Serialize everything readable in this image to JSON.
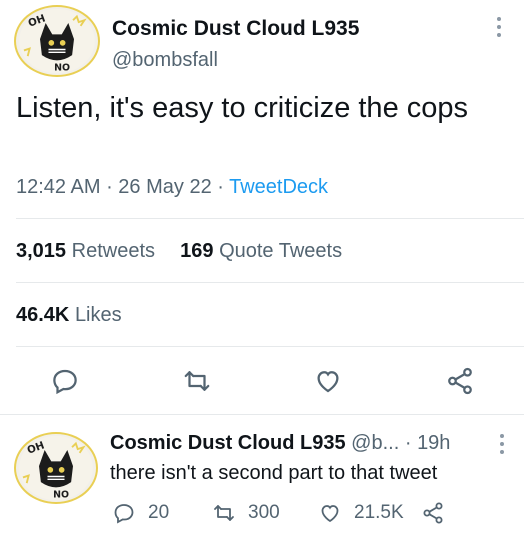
{
  "tweet": {
    "author_name": "Cosmic Dust Cloud L935",
    "author_handle": "@bombsfall",
    "text": "Listen, it's easy to criticize the cops",
    "time": "12:42 AM",
    "date": "26 May 22",
    "source": "TweetDeck",
    "retweets_count": "3,015",
    "retweets_label": "Retweets",
    "quotes_count": "169",
    "quotes_label": "Quote Tweets",
    "likes_count": "46.4K",
    "likes_label": "Likes"
  },
  "avatar": {
    "badge_text": "OH",
    "lower_text": "NO"
  },
  "reply": {
    "author_name": "Cosmic Dust Cloud L935",
    "author_handle": "@b...",
    "time": "19h",
    "text": "there isn't a second part to that tweet",
    "reply_count": "20",
    "retweet_count": "300",
    "like_count": "21.5K"
  },
  "icons": {
    "reply": "reply-icon",
    "retweet": "retweet-icon",
    "like": "heart-icon",
    "share": "share-icon",
    "more": "more-vertical-icon"
  },
  "colors": {
    "text": "#0f1419",
    "muted": "#536471",
    "link": "#1d9bf0",
    "divider": "#e6e9eb"
  }
}
